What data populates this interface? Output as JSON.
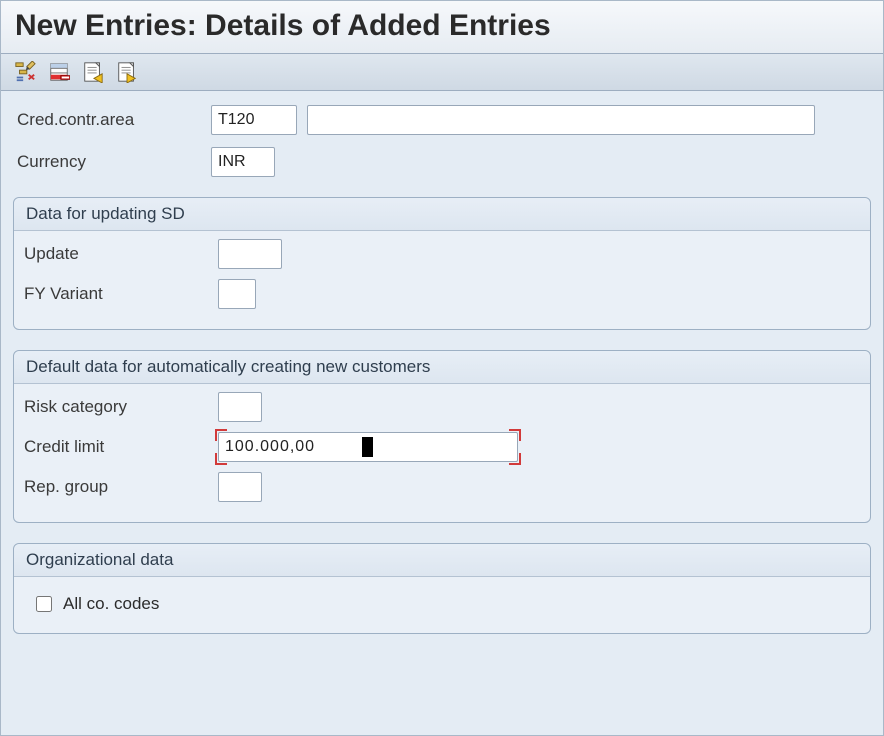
{
  "title": "New Entries: Details of Added Entries",
  "toolbar": {
    "icons": {
      "toggle_edit": "toggle-edit-icon",
      "delete": "delete-icon",
      "previous": "previous-entry-icon",
      "next": "next-entry-icon"
    }
  },
  "header": {
    "cred_contr_area": {
      "label": "Cred.contr.area",
      "value": "T120",
      "description": ""
    },
    "currency": {
      "label": "Currency",
      "value": "INR"
    }
  },
  "group_sd": {
    "title": "Data for updating SD",
    "update": {
      "label": "Update",
      "value": ""
    },
    "fy_variant": {
      "label": "FY Variant",
      "value": ""
    }
  },
  "group_default": {
    "title": "Default data for automatically creating new customers",
    "risk_category": {
      "label": "Risk category",
      "value": ""
    },
    "credit_limit": {
      "label": "Credit limit",
      "value": "100.000,00"
    },
    "rep_group": {
      "label": "Rep. group",
      "value": ""
    }
  },
  "group_org": {
    "title": "Organizational data",
    "all_co_codes": {
      "label": "All co. codes",
      "checked": false
    }
  }
}
